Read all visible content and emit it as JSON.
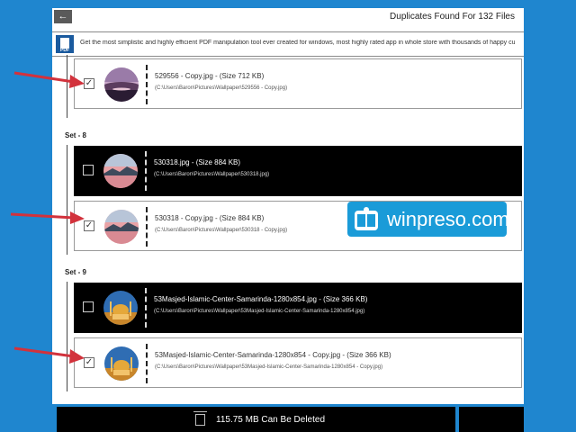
{
  "window": {
    "title": "Duplicates Found For 132 Files",
    "back_label": "←"
  },
  "banner": {
    "icon_name": "pdf-tool-icon",
    "icon_label": "PDF",
    "text": "Get the most simplistic and highly efficient PDF manipulation tool ever created for windows, most highly rated app in whole store with thousands of happy cu"
  },
  "groups": [
    {
      "label": "",
      "rows": [
        {
          "checked": true,
          "style": "light",
          "name": "529556 - Copy.jpg - (Size 712 KB)",
          "path": "(C:\\Users\\Baron\\Pictures\\Wallpaper\\529556 - Copy.jpg)",
          "thumb": "purple-sunset-thumbnail",
          "arrow": true
        }
      ]
    },
    {
      "label": "Set - 8",
      "rows": [
        {
          "checked": false,
          "style": "dark",
          "name": "530318.jpg - (Size 884 KB)",
          "path": "(C:\\Users\\Baron\\Pictures\\Wallpaper\\530318.jpg)",
          "thumb": "pink-lake-thumbnail",
          "arrow": false
        },
        {
          "checked": true,
          "style": "light",
          "name": "530318 - Copy.jpg - (Size 884 KB)",
          "path": "(C:\\Users\\Baron\\Pictures\\Wallpaper\\530318 - Copy.jpg)",
          "thumb": "pink-lake-thumbnail",
          "arrow": true
        }
      ]
    },
    {
      "label": "Set - 9",
      "rows": [
        {
          "checked": false,
          "style": "dark",
          "name": "53Masjed-Islamic-Center-Samarinda-1280x854.jpg - (Size 366 KB)",
          "path": "(C:\\Users\\Baron\\Pictures\\Wallpaper\\53Masjed-Islamic-Center-Samarinda-1280x854.jpg)",
          "thumb": "mosque-thumbnail",
          "arrow": false
        },
        {
          "checked": true,
          "style": "light",
          "name": "53Masjed-Islamic-Center-Samarinda-1280x854 - Copy.jpg - (Size 366 KB)",
          "path": "(C:\\Users\\Baron\\Pictures\\Wallpaper\\53Masjed-Islamic-Center-Samarinda-1280x854 - Copy.jpg)",
          "thumb": "mosque-thumbnail",
          "arrow": true
        }
      ]
    }
  ],
  "watermark": {
    "text": "winpreso.com"
  },
  "footer": {
    "delete_label": "115.75 MB Can Be Deleted",
    "icon_name": "trash-icon"
  },
  "colors": {
    "background": "#1f86cf",
    "arrow": "#d2323c",
    "dark_row": "#000000",
    "watermark": "#1a9bd8"
  }
}
